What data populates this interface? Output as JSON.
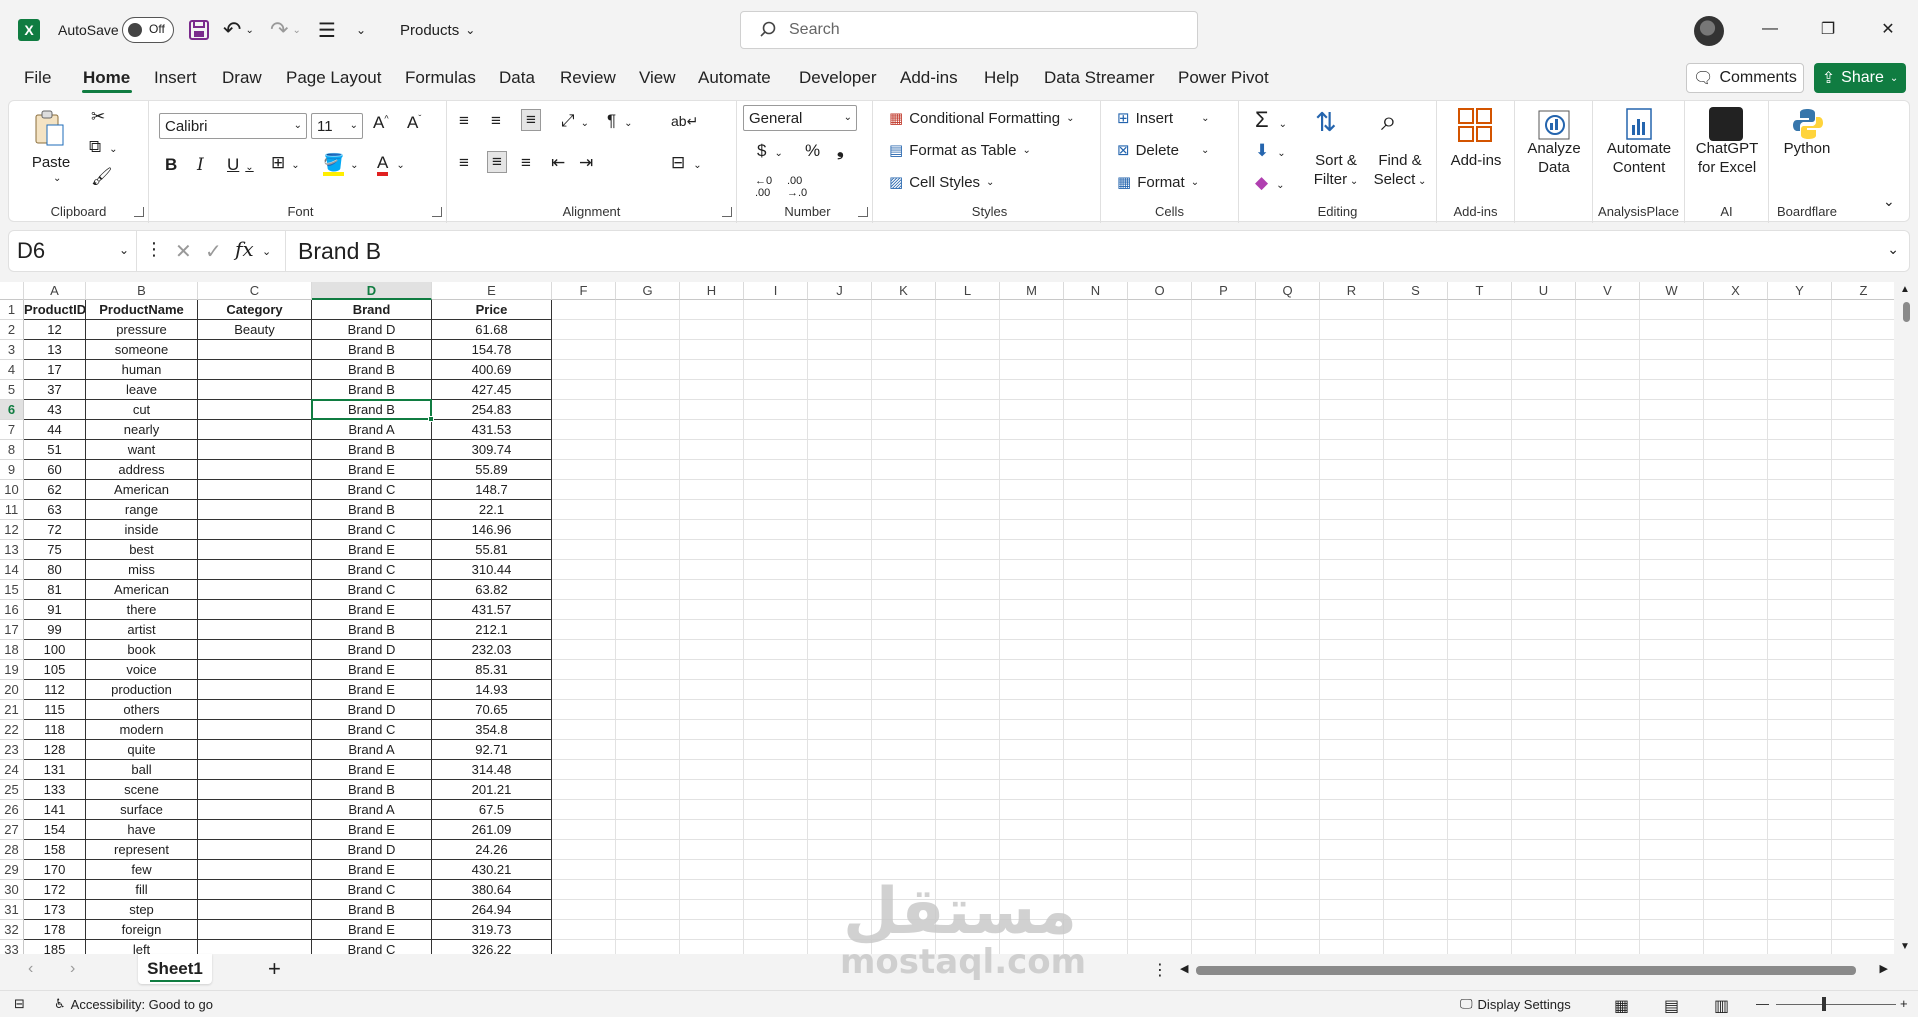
{
  "titlebar": {
    "app_logo": "X",
    "autosave_label": "AutoSave",
    "autosave_state": "Off",
    "doc_title": "Products",
    "search_placeholder": "Search"
  },
  "menu": {
    "tabs": [
      "File",
      "Home",
      "Insert",
      "Draw",
      "Page Layout",
      "Formulas",
      "Data",
      "Review",
      "View",
      "Automate",
      "Developer",
      "Add-ins",
      "Help",
      "Data Streamer",
      "Power Pivot"
    ],
    "active_tab": "Home",
    "comments_label": "Comments",
    "share_label": "Share"
  },
  "ribbon": {
    "clipboard": {
      "label": "Clipboard",
      "paste": "Paste"
    },
    "font": {
      "label": "Font",
      "font_name": "Calibri",
      "font_size": "11"
    },
    "alignment": {
      "label": "Alignment"
    },
    "number": {
      "label": "Number",
      "format": "General"
    },
    "styles": {
      "label": "Styles",
      "conditional_formatting": "Conditional Formatting",
      "format_as_table": "Format as Table",
      "cell_styles": "Cell Styles"
    },
    "cells": {
      "label": "Cells",
      "insert": "Insert",
      "delete": "Delete",
      "format": "Format"
    },
    "editing": {
      "label": "Editing",
      "sort_filter_1": "Sort &",
      "sort_filter_2": "Filter",
      "find_select_1": "Find &",
      "find_select_2": "Select"
    },
    "addins": {
      "label": "Add-ins",
      "addins_btn": "Add-ins"
    },
    "analyze": {
      "line1": "Analyze",
      "line2": "Data"
    },
    "analysisplace": {
      "label": "AnalysisPlace",
      "line1": "Automate",
      "line2": "Content"
    },
    "ai": {
      "label": "AI",
      "line1": "ChatGPT",
      "line2": "for Excel"
    },
    "boardflare": {
      "label": "Boardflare",
      "python": "Python"
    }
  },
  "formula_bar": {
    "name_box": "D6",
    "fx": "fx",
    "content": "Brand B"
  },
  "grid": {
    "columns": [
      "A",
      "B",
      "C",
      "D",
      "E",
      "F",
      "G",
      "H",
      "I",
      "J",
      "K",
      "L",
      "M",
      "N",
      "O",
      "P",
      "Q",
      "R",
      "S",
      "T",
      "U",
      "V",
      "W",
      "X",
      "Y",
      "Z"
    ],
    "selected_column": "D",
    "selected_row": 6,
    "headers": [
      "ProductID",
      "ProductName",
      "Category",
      "Brand",
      "Price"
    ],
    "rows": [
      [
        "12",
        "pressure",
        "Beauty",
        "Brand D",
        "61.68"
      ],
      [
        "13",
        "someone",
        "",
        "Brand B",
        "154.78"
      ],
      [
        "17",
        "human",
        "",
        "Brand B",
        "400.69"
      ],
      [
        "37",
        "leave",
        "",
        "Brand B",
        "427.45"
      ],
      [
        "43",
        "cut",
        "",
        "Brand B",
        "254.83"
      ],
      [
        "44",
        "nearly",
        "",
        "Brand A",
        "431.53"
      ],
      [
        "51",
        "want",
        "",
        "Brand B",
        "309.74"
      ],
      [
        "60",
        "address",
        "",
        "Brand E",
        "55.89"
      ],
      [
        "62",
        "American",
        "",
        "Brand C",
        "148.7"
      ],
      [
        "63",
        "range",
        "",
        "Brand B",
        "22.1"
      ],
      [
        "72",
        "inside",
        "",
        "Brand C",
        "146.96"
      ],
      [
        "75",
        "best",
        "",
        "Brand E",
        "55.81"
      ],
      [
        "80",
        "miss",
        "",
        "Brand C",
        "310.44"
      ],
      [
        "81",
        "American",
        "",
        "Brand C",
        "63.82"
      ],
      [
        "91",
        "there",
        "",
        "Brand E",
        "431.57"
      ],
      [
        "99",
        "artist",
        "",
        "Brand B",
        "212.1"
      ],
      [
        "100",
        "book",
        "",
        "Brand D",
        "232.03"
      ],
      [
        "105",
        "voice",
        "",
        "Brand E",
        "85.31"
      ],
      [
        "112",
        "production",
        "",
        "Brand E",
        "14.93"
      ],
      [
        "115",
        "others",
        "",
        "Brand D",
        "70.65"
      ],
      [
        "118",
        "modern",
        "",
        "Brand C",
        "354.8"
      ],
      [
        "128",
        "quite",
        "",
        "Brand A",
        "92.71"
      ],
      [
        "131",
        "ball",
        "",
        "Brand E",
        "314.48"
      ],
      [
        "133",
        "scene",
        "",
        "Brand B",
        "201.21"
      ],
      [
        "141",
        "surface",
        "",
        "Brand A",
        "67.5"
      ],
      [
        "154",
        "have",
        "",
        "Brand E",
        "261.09"
      ],
      [
        "158",
        "represent",
        "",
        "Brand D",
        "24.26"
      ],
      [
        "170",
        "few",
        "",
        "Brand E",
        "430.21"
      ],
      [
        "172",
        "fill",
        "",
        "Brand C",
        "380.64"
      ],
      [
        "173",
        "step",
        "",
        "Brand B",
        "264.94"
      ],
      [
        "178",
        "foreign",
        "",
        "Brand E",
        "319.73"
      ],
      [
        "185",
        "left",
        "",
        "Brand C",
        "326.22"
      ]
    ]
  },
  "sheets": {
    "active": "Sheet1"
  },
  "status": {
    "accessibility": "Accessibility: Good to go",
    "display_settings": "Display Settings"
  },
  "watermark": {
    "arabic": "مستقل",
    "latin": "mostaql.com"
  },
  "colors": {
    "accent": "#107c41",
    "toolbar_bg": "#f3f3f3"
  }
}
